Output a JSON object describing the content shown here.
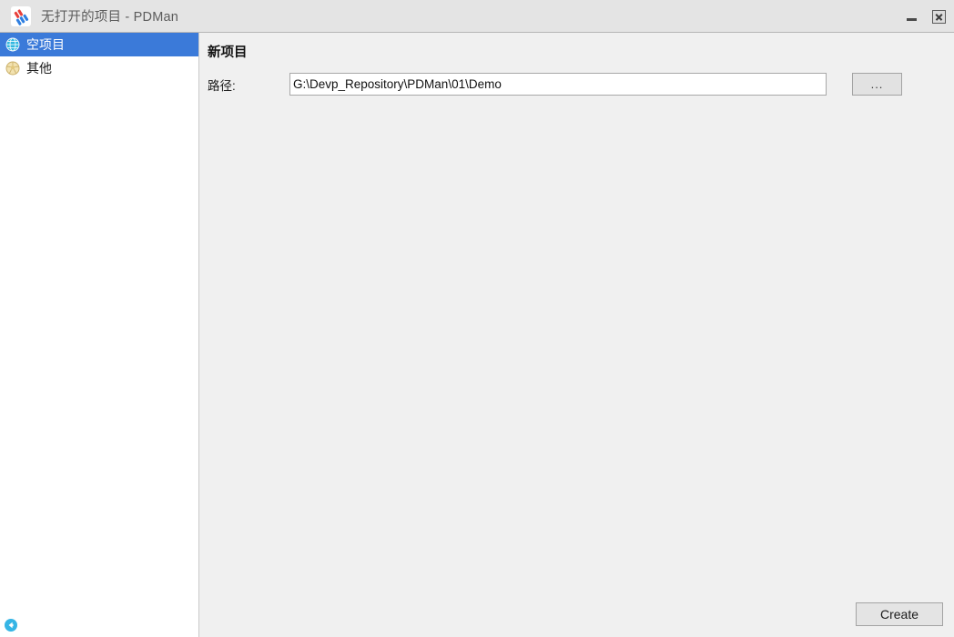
{
  "window": {
    "title": "无打开的项目 - PDMan",
    "app_icon": "pdman-logo-icon",
    "controls": {
      "minimize": "minimize-icon",
      "close": "close-icon"
    }
  },
  "sidebar": {
    "items": [
      {
        "label": "空项目",
        "icon": "globe-icon",
        "selected": true
      },
      {
        "label": "其他",
        "icon": "ball-icon",
        "selected": false
      }
    ],
    "footer": {
      "icon": "back-circle-icon"
    }
  },
  "main": {
    "title": "新项目",
    "form": {
      "path_label": "路径:",
      "path_value": "G:\\Devp_Repository\\PDMan\\01\\Demo",
      "path_placeholder": "",
      "browse_label": "..."
    },
    "footer": {
      "create_label": "Create"
    }
  },
  "colors": {
    "titlebar_bg": "#e4e4e4",
    "selection_blue": "#3b7ad9",
    "panel_bg": "#f0f0f0",
    "sidebar_bg": "#ffffff",
    "accent_cyan": "#30b7e0",
    "icon_gold": "#e8d08a"
  }
}
